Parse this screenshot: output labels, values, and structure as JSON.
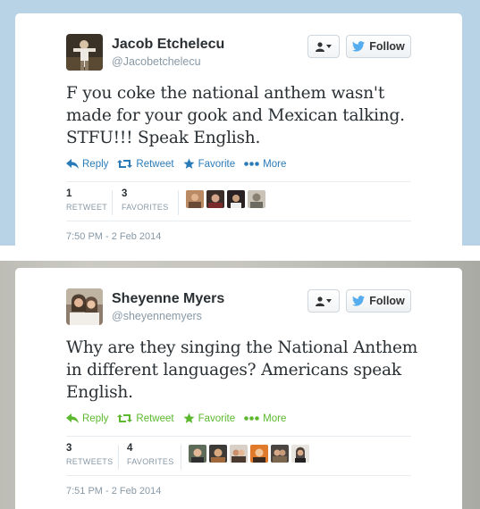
{
  "colors": {
    "top_background": "#b8d3e6",
    "reply_blue": "#2b7bb9",
    "action_green": "#5cb82e",
    "twitter_blue": "#55acee"
  },
  "tweets": [
    {
      "name": "Jacob Etchelecu",
      "handle": "@Jacobetchelecu",
      "text": "F you coke the national anthem wasn't made for your gook and Mexican talking. STFU!!! Speak English.",
      "actions": {
        "reply": "Reply",
        "retweet": "Retweet",
        "favorite": "Favorite",
        "more": "More"
      },
      "stats": {
        "retweets_count": "1",
        "retweets_label": "RETWEET",
        "favorites_count": "3",
        "favorites_label": "FAVORITES"
      },
      "timestamp": "7:50 PM - 2 Feb 2014",
      "follow_label": "Follow"
    },
    {
      "name": "Sheyenne Myers",
      "handle": "@sheyennemyers",
      "text": "Why are they singing the National Anthem in different languages? Americans speak English.",
      "actions": {
        "reply": "Reply",
        "retweet": "Retweet",
        "favorite": "Favorite",
        "more": "More"
      },
      "stats": {
        "retweets_count": "3",
        "retweets_label": "RETWEETS",
        "favorites_count": "4",
        "favorites_label": "FAVORITES"
      },
      "timestamp": "7:51 PM - 2 Feb 2014",
      "follow_label": "Follow"
    }
  ]
}
